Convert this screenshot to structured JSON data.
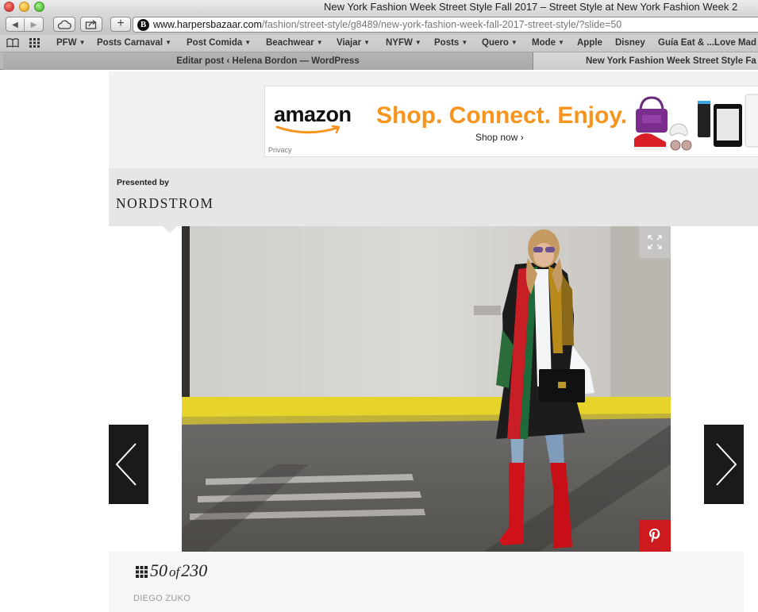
{
  "window": {
    "title": "New York Fashion Week Street Style Fall 2017 – Street Style at New York Fashion Week 2"
  },
  "toolbar": {
    "back_icon": "back-arrow-icon",
    "forward_icon": "forward-arrow-icon",
    "icloud_icon": "cloud-icon",
    "share_icon": "share-icon",
    "new_tab_label": "+",
    "favicon_letter": "B",
    "url_domain": "www.harpersbazaar.com",
    "url_path": "/fashion/street-style/g8489/new-york-fashion-week-fall-2017-street-style/?slide=50"
  },
  "bookmarks": {
    "items": [
      {
        "label": "PFW",
        "menu": true
      },
      {
        "label": "Posts Carnaval",
        "menu": true
      },
      {
        "label": "Post Comida",
        "menu": true
      },
      {
        "label": "Beachwear",
        "menu": true
      },
      {
        "label": "Viajar",
        "menu": true
      },
      {
        "label": "NYFW",
        "menu": true
      },
      {
        "label": "Posts",
        "menu": true
      },
      {
        "label": "Quero",
        "menu": true
      },
      {
        "label": "Mode",
        "menu": true
      },
      {
        "label": "Apple",
        "menu": false
      },
      {
        "label": "Disney",
        "menu": false
      },
      {
        "label": "Guía Eat & ...Love Mad",
        "menu": false
      }
    ]
  },
  "tabs": [
    {
      "label": "Editar post ‹ Helena Bordon — WordPress",
      "active": false
    },
    {
      "label": "New York Fashion Week Street Style Fa",
      "active": true
    }
  ],
  "ad": {
    "brand": "amazon",
    "headline": "Shop. Connect. Enjoy.",
    "cta": "Shop now ›",
    "privacy": "Privacy",
    "colors": {
      "accent": "#f7941d",
      "smile": "#f7941d"
    }
  },
  "presented_by": {
    "label": "Presented by",
    "sponsor": "NORDSTROM"
  },
  "slideshow": {
    "current": "50",
    "of": "of",
    "total": "230",
    "credit": "DIEGO ZUKO",
    "expand_icon": "expand-icon",
    "pin_icon": "pinterest-icon",
    "prev_icon": "chevron-left-icon",
    "next_icon": "chevron-right-icon",
    "grid_icon": "grid-icon",
    "colors": {
      "pin": "#cc1a1f",
      "arrow_bg": "#1a1a1a"
    }
  }
}
